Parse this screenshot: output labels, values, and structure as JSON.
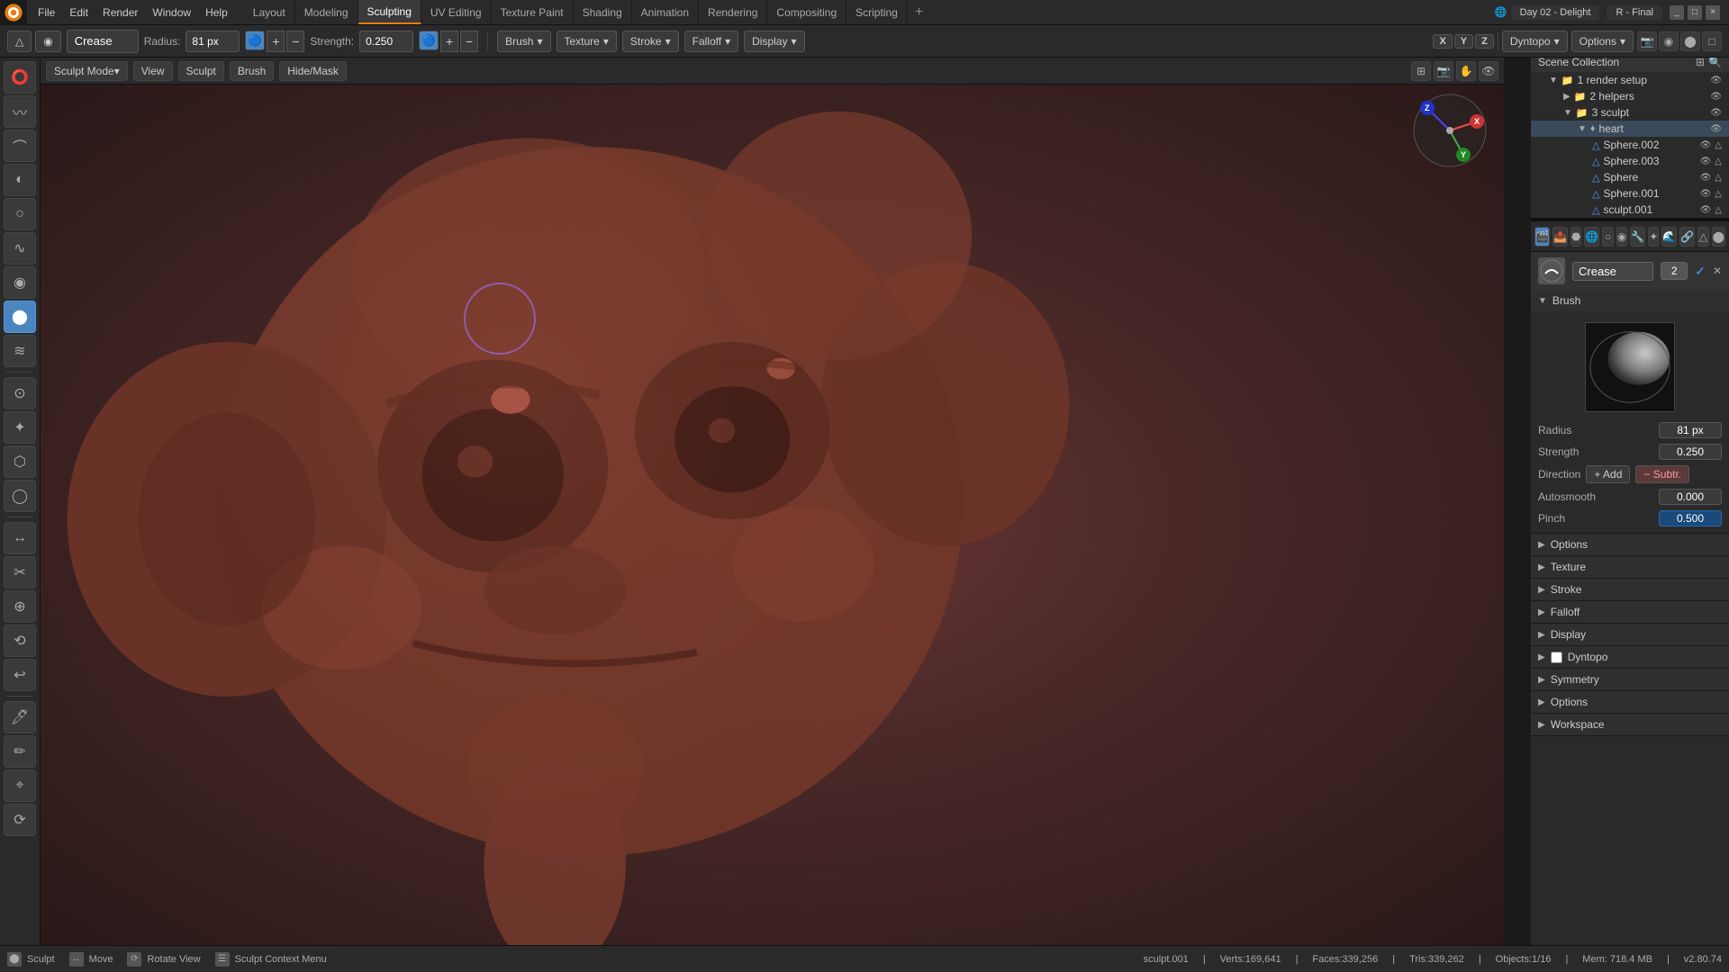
{
  "window": {
    "title": "Day 02 - Delight",
    "scene": "R - Final"
  },
  "top_menu": {
    "items": [
      "File",
      "Edit",
      "Render",
      "Window",
      "Help"
    ]
  },
  "workspace_tabs": [
    {
      "label": "Layout",
      "active": false
    },
    {
      "label": "Modeling",
      "active": false
    },
    {
      "label": "Sculpting",
      "active": true
    },
    {
      "label": "UV Editing",
      "active": false
    },
    {
      "label": "Texture Paint",
      "active": false
    },
    {
      "label": "Shading",
      "active": false
    },
    {
      "label": "Animation",
      "active": false
    },
    {
      "label": "Rendering",
      "active": false
    },
    {
      "label": "Compositing",
      "active": false
    },
    {
      "label": "Scripting",
      "active": false
    }
  ],
  "toolbar": {
    "brush_name": "Crease",
    "radius_label": "Radius:",
    "radius_value": "81 px",
    "strength_label": "Strength:",
    "strength_value": "0.250",
    "brush_dropdown": "Brush",
    "texture_dropdown": "Texture",
    "stroke_dropdown": "Stroke",
    "falloff_dropdown": "Falloff",
    "display_dropdown": "Display",
    "dyntopo_dropdown": "Dyntopo",
    "options_dropdown": "Options"
  },
  "viewport_header": {
    "sculpt_mode": "Sculpt Mode",
    "view_btn": "View",
    "sculpt_btn": "Sculpt",
    "brush_btn": "Brush",
    "hide_mask_btn": "Hide/Mask"
  },
  "left_tools": [
    {
      "icon": "⭕",
      "name": "draw",
      "active": false
    },
    {
      "icon": "〰",
      "name": "draw-sharp",
      "active": false
    },
    {
      "icon": "⌒",
      "name": "clay",
      "active": false
    },
    {
      "icon": "◐",
      "name": "clay-strips",
      "active": false
    },
    {
      "icon": "○",
      "name": "clay-thumb",
      "active": false
    },
    {
      "icon": "∿",
      "name": "layer",
      "active": false
    },
    {
      "icon": "◉",
      "name": "inflate",
      "active": false
    },
    {
      "icon": "⬤",
      "name": "blob",
      "active": true
    },
    {
      "icon": "≋",
      "name": "crease",
      "active": false
    },
    {
      "icon": "⊙",
      "name": "smooth",
      "active": false
    },
    {
      "icon": "✦",
      "name": "flatten",
      "active": false
    },
    {
      "icon": "⬡",
      "name": "fill",
      "active": false
    },
    {
      "icon": "◯",
      "name": "scrape",
      "active": false
    },
    {
      "icon": "⬣",
      "name": "multiplane-scrape",
      "active": false
    },
    {
      "icon": "↔",
      "name": "pinch",
      "active": false
    },
    {
      "icon": "✂",
      "name": "grab",
      "active": false
    },
    {
      "icon": "⊕",
      "name": "elastic-deform",
      "active": false
    },
    {
      "icon": "⟲",
      "name": "snake-hook",
      "active": false
    },
    {
      "icon": "↩",
      "name": "thumb",
      "active": false
    },
    {
      "icon": "🖊",
      "name": "pose",
      "active": false
    },
    {
      "icon": "✏",
      "name": "nudge",
      "active": false
    },
    {
      "icon": "⌖",
      "name": "rotate",
      "active": false
    },
    {
      "icon": "⟳",
      "name": "slide-relax",
      "active": false
    }
  ],
  "outliner": {
    "title": "Scene Collection",
    "items": [
      {
        "label": "1 render setup",
        "indent": 1,
        "icon": "collection",
        "expanded": true
      },
      {
        "label": "2 helpers",
        "indent": 2,
        "icon": "collection",
        "expanded": false
      },
      {
        "label": "3 sculpt",
        "indent": 2,
        "icon": "collection",
        "expanded": true
      },
      {
        "label": "heart",
        "indent": 3,
        "icon": "object",
        "expanded": true
      },
      {
        "label": "Sphere.002",
        "indent": 4,
        "icon": "mesh"
      },
      {
        "label": "Sphere.003",
        "indent": 4,
        "icon": "mesh"
      },
      {
        "label": "Sphere",
        "indent": 4,
        "icon": "mesh"
      },
      {
        "label": "Sphere.001",
        "indent": 4,
        "icon": "mesh"
      },
      {
        "label": "sculpt.001",
        "indent": 4,
        "icon": "mesh"
      }
    ]
  },
  "sculpt_panel": {
    "brush_title": "Brush",
    "crease_label": "Crease",
    "crease_number": "2",
    "radius_label": "Radius",
    "radius_value": "81 px",
    "strength_label": "Strength",
    "strength_value": "0.250",
    "direction_label": "Direction",
    "add_label": "Add",
    "subtr_label": "Subtr.",
    "autosmooth_label": "Autosmooth",
    "autosmooth_value": "0.000",
    "pinch_label": "Pinch",
    "pinch_value": "0.500",
    "options_label": "Options",
    "texture_label": "Texture",
    "stroke_label": "Stroke",
    "falloff_label": "Falloff",
    "display_label": "Display",
    "dyntopo_label": "Dyntopo",
    "symmetry_label": "Symmetry",
    "options2_label": "Options",
    "workspace_label": "Workspace"
  },
  "status_bar": {
    "sculpt_label": "Sculpt",
    "move_label": "Move",
    "rotate_view_label": "Rotate View",
    "context_menu_label": "Sculpt Context Menu",
    "object_name": "sculpt.001",
    "verts": "Verts:169,641",
    "faces": "Faces:339,256",
    "tris": "Tris:339,262",
    "objects": "Objects:1/16",
    "memory": "Mem: 718.4 MB",
    "version": "v2.80.74"
  },
  "axes": [
    "X",
    "Y",
    "Z"
  ],
  "icons": {
    "collection": "📁",
    "mesh": "△",
    "eye": "👁",
    "camera": "📷",
    "render": "🎬"
  }
}
